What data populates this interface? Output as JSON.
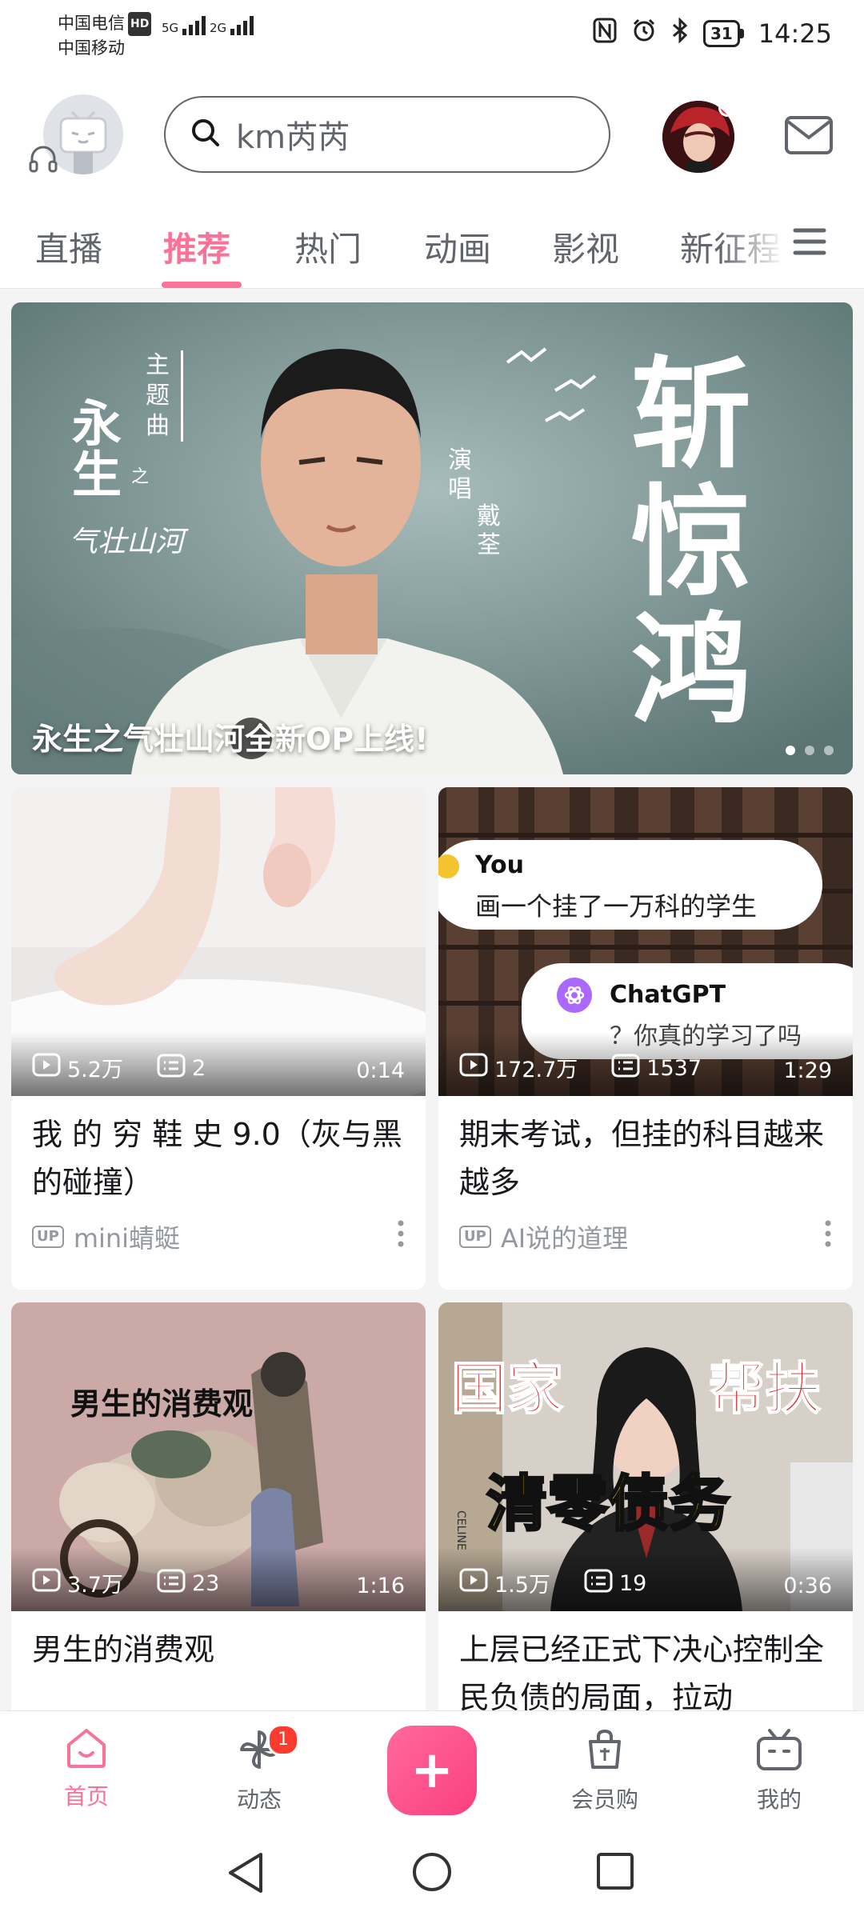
{
  "status_bar": {
    "carrier1": "中国电信",
    "hd": "HD",
    "carrier2": "中国移动",
    "net1": "5G",
    "net2": "2G",
    "battery": "31",
    "time": "14:25",
    "icons": [
      "nfc-icon",
      "alarm-icon",
      "bluetooth-icon"
    ]
  },
  "header": {
    "search_text": "km芮芮",
    "icons": [
      "tv-mascot-avatar",
      "headphone-icon",
      "search-icon",
      "user-avatar",
      "mail-icon"
    ]
  },
  "tabs": {
    "items": [
      "直播",
      "推荐",
      "热门",
      "动画",
      "影视",
      "新征程"
    ],
    "active": "推荐"
  },
  "banner": {
    "caption": "永生之气壮山河全新OP上线!",
    "art": {
      "theme_song": "主题曲",
      "show_title": "永生",
      "show_title_small": "之",
      "show_subtitle": "气壮山河",
      "singer_label": "演唱",
      "singer": "戴荃",
      "song": "斩惊鸿"
    }
  },
  "cards": [
    {
      "title": "我 的 穷 鞋 史 9.0（灰与黑的碰撞）",
      "views": "5.2万",
      "comments": "2",
      "duration": "0:14",
      "up_badge": "UP",
      "uploader": "mini蜻蜓"
    },
    {
      "title": "期末考试，但挂的科目越来越多",
      "views": "172.7万",
      "comments": "1537",
      "duration": "1:29",
      "up_badge": "UP",
      "uploader": "AI说的道理",
      "thumb_text": {
        "you_label": "You",
        "you_msg": "画一个挂了一万科的学生",
        "gpt_label": "ChatGPT",
        "gpt_msg": "？你真的学习了吗"
      }
    },
    {
      "title": "男生的消费观",
      "views": "3.7万",
      "comments": "23",
      "duration": "1:16",
      "thumb_text": {
        "caption": "男生的消费观"
      }
    },
    {
      "title": "上层已经正式下决心控制全民负债的局面，拉动",
      "views": "1.5万",
      "comments": "19",
      "duration": "0:36",
      "thumb_text": {
        "line1a": "国家",
        "line1b": "帮扶",
        "line2": "清零债务",
        "book": "CELINE"
      }
    }
  ],
  "bottom_nav": {
    "home": "首页",
    "dynamic": "动态",
    "dynamic_badge": "1",
    "plus": "+",
    "shop": "会员购",
    "mine": "我的"
  },
  "colors": {
    "brand_pink": "#fb7299",
    "text_primary": "#18191c",
    "text_secondary": "#61666d",
    "text_muted": "#9499a0"
  }
}
